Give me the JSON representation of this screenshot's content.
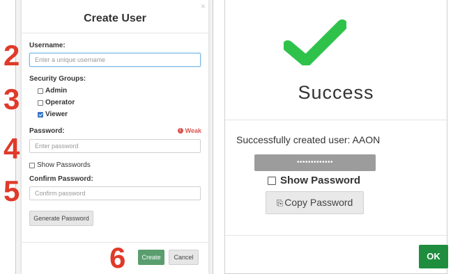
{
  "create_user": {
    "title": "Create User",
    "close_glyph": "×",
    "username_label": "Username:",
    "username_placeholder": "Enter a unique username",
    "security_groups_label": "Security Groups:",
    "groups": [
      {
        "label": "Admin",
        "checked": false
      },
      {
        "label": "Operator",
        "checked": false
      },
      {
        "label": "Viewer",
        "checked": true
      }
    ],
    "password_label": "Password:",
    "password_strength": "Weak",
    "password_strength_icon": "!",
    "password_placeholder": "Enter password",
    "show_passwords_label": "Show Passwords",
    "confirm_password_label": "Confirm Password:",
    "confirm_password_placeholder": "Confirm password",
    "generate_button": "Generate Password",
    "create_button": "Create",
    "cancel_button": "Cancel"
  },
  "steps": [
    "2",
    "3",
    "4",
    "5",
    "6"
  ],
  "success": {
    "title": "Success",
    "message": "Successfully created user: AAON",
    "masked_password": "•••••••••••••",
    "show_password_label": "Show Password",
    "copy_button": "Copy Password",
    "copy_icon": "⎘",
    "ok_button": "OK"
  },
  "colors": {
    "step_number": "#e03a2a",
    "create_button": "#5a9e6f",
    "ok_button": "#1e8e3e",
    "checkmark": "#2fc24a",
    "weak": "#d9534f"
  }
}
